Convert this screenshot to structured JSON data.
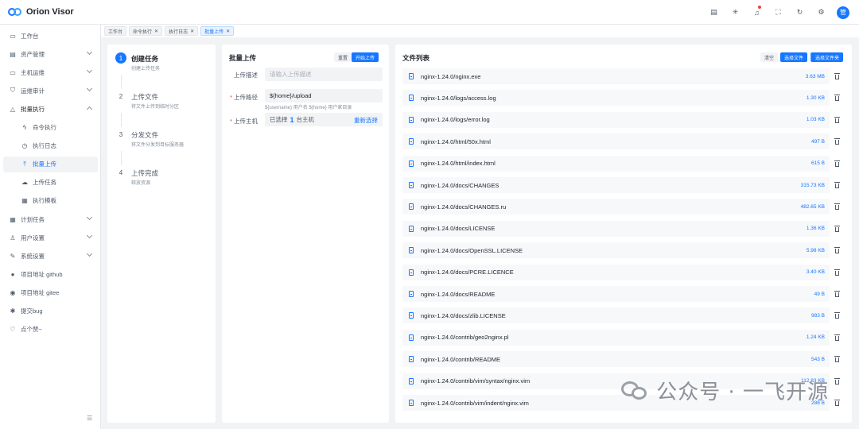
{
  "app": {
    "name": "Orion Visor",
    "avatar_text": "管"
  },
  "header_icons": [
    "doc-icon",
    "sun-icon",
    "bell-icon",
    "fullscreen-icon",
    "refresh-icon",
    "gear-icon"
  ],
  "sidebar": {
    "items": [
      {
        "label": "工作台",
        "icon": "monitor-icon"
      },
      {
        "label": "资产管理",
        "icon": "database-icon",
        "arrow": "down"
      },
      {
        "label": "主机运维",
        "icon": "desktop-icon",
        "arrow": "down"
      },
      {
        "label": "运维审计",
        "icon": "shield-icon",
        "arrow": "down"
      },
      {
        "label": "批量执行",
        "icon": "cluster-icon",
        "arrow": "up",
        "open": true
      },
      {
        "label": "命令执行",
        "icon": "bolt-icon",
        "sub": true
      },
      {
        "label": "执行日志",
        "icon": "history-icon",
        "sub": true
      },
      {
        "label": "批量上传",
        "icon": "upload-icon",
        "sub": true,
        "active": true
      },
      {
        "label": "上传任务",
        "icon": "cloud-icon",
        "sub": true
      },
      {
        "label": "执行模板",
        "icon": "template-icon",
        "sub": true
      },
      {
        "label": "计划任务",
        "icon": "calendar-icon",
        "arrow": "down"
      },
      {
        "label": "用户设置",
        "icon": "user-icon",
        "arrow": "down"
      },
      {
        "label": "系统设置",
        "icon": "tool-icon",
        "arrow": "down"
      },
      {
        "label": "项目地址 github",
        "icon": "github-icon"
      },
      {
        "label": "项目地址 gitee",
        "icon": "gitee-icon"
      },
      {
        "label": "提交bug",
        "icon": "bug-icon"
      },
      {
        "label": "点个赞~",
        "icon": "thumb-icon"
      }
    ]
  },
  "tabs": [
    {
      "label": "工作台",
      "closable": false
    },
    {
      "label": "命令执行",
      "closable": true
    },
    {
      "label": "执行日志",
      "closable": true
    },
    {
      "label": "批量上传",
      "closable": true,
      "active": true
    }
  ],
  "steps": [
    {
      "num": "1",
      "title": "创建任务",
      "desc": "创建上传任务",
      "active": true
    },
    {
      "num": "2",
      "title": "上传文件",
      "desc": "将文件上传到临时分区"
    },
    {
      "num": "3",
      "title": "分发文件",
      "desc": "将文件分发到目标服务器"
    },
    {
      "num": "4",
      "title": "上传完成",
      "desc": "释放资源"
    }
  ],
  "upload_form": {
    "title": "批量上传",
    "reset_label": "重置",
    "start_label": "开始上传",
    "desc_label": "上传描述",
    "desc_placeholder": "请输入上传描述",
    "path_label": "上传路径",
    "path_value": "${home}/upload",
    "path_help": "${username} 用户名 ${home} 用户家目录",
    "host_label": "上传主机",
    "host_prefix": "已选择",
    "host_count": "1",
    "host_suffix": "台主机",
    "host_reselect": "重新选择"
  },
  "file_list": {
    "title": "文件列表",
    "clear_label": "清空",
    "select_file_label": "选择文件",
    "select_folder_label": "选择文件夹",
    "files": [
      {
        "name": "nginx-1.24.0/nginx.exe",
        "size": "3.63 MB"
      },
      {
        "name": "nginx-1.24.0/logs/access.log",
        "size": "1.30 KB"
      },
      {
        "name": "nginx-1.24.0/logs/error.log",
        "size": "1.03 KB"
      },
      {
        "name": "nginx-1.24.0/html/50x.html",
        "size": "497 B"
      },
      {
        "name": "nginx-1.24.0/html/index.html",
        "size": "615 B"
      },
      {
        "name": "nginx-1.24.0/docs/CHANGES",
        "size": "315.73 KB"
      },
      {
        "name": "nginx-1.24.0/docs/CHANGES.ru",
        "size": "482.65 KB"
      },
      {
        "name": "nginx-1.24.0/docs/LICENSE",
        "size": "1.36 KB"
      },
      {
        "name": "nginx-1.24.0/docs/OpenSSL.LICENSE",
        "size": "5.98 KB"
      },
      {
        "name": "nginx-1.24.0/docs/PCRE.LICENCE",
        "size": "3.40 KB"
      },
      {
        "name": "nginx-1.24.0/docs/README",
        "size": "49 B"
      },
      {
        "name": "nginx-1.24.0/docs/zlib.LICENSE",
        "size": "983 B"
      },
      {
        "name": "nginx-1.24.0/contrib/geo2nginx.pl",
        "size": "1.24 KB"
      },
      {
        "name": "nginx-1.24.0/contrib/README",
        "size": "543 B"
      },
      {
        "name": "nginx-1.24.0/contrib/vim/syntax/nginx.vim",
        "size": "112.83 KB"
      },
      {
        "name": "nginx-1.24.0/contrib/vim/indent/nginx.vim",
        "size": "286 B"
      }
    ]
  },
  "watermark": {
    "text": "公众号 · 一飞开源"
  }
}
